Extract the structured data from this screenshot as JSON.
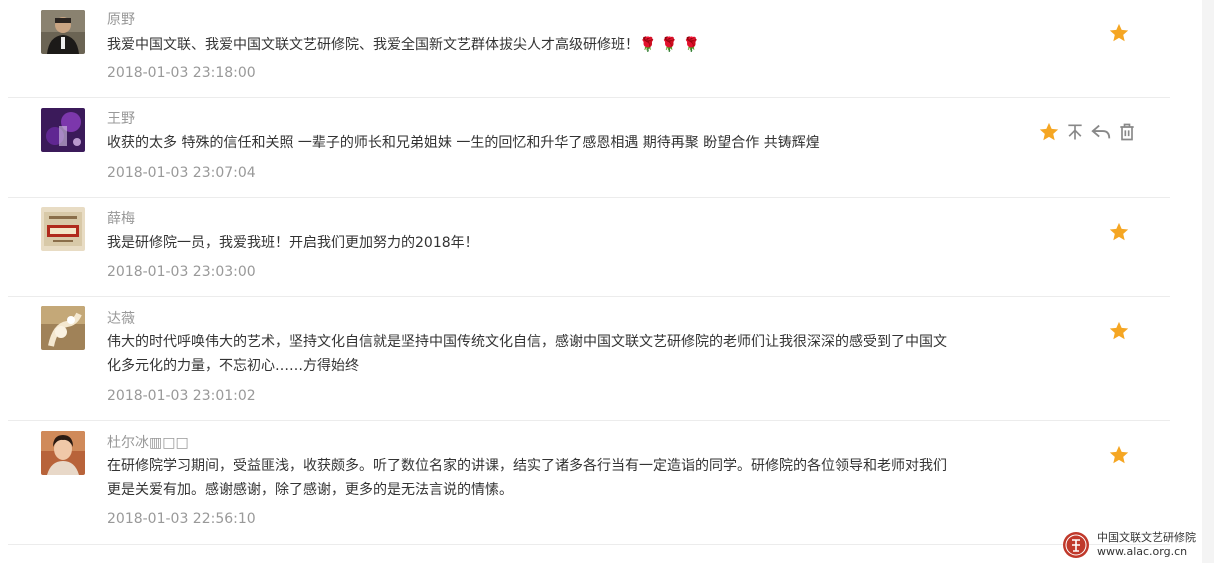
{
  "comments": [
    {
      "username": "原野",
      "content": "我爱中国文联、我爱中国文联文艺研修院、我爱全国新文艺群体拔尖人才高级研修班！",
      "emoji": "🌹 🌹 🌹",
      "time": "2018-01-03 23:18:00",
      "avatar_icon": "portrait-man-icon",
      "starred": true
    },
    {
      "username": "王野",
      "content": "收获的太多 特殊的信任和关照 一辈子的师长和兄弟姐妹 一生的回忆和升华了感恩相遇 期待再聚 盼望合作 共铸辉煌",
      "time": "2018-01-03 23:07:04",
      "avatar_icon": "purple-stage-icon",
      "starred": true,
      "actions": [
        "star-icon",
        "pin-top-icon",
        "reply-icon",
        "delete-icon"
      ]
    },
    {
      "username": "薛梅",
      "content": "我是研修院一员，我爱我班！开启我们更加努力的2018年！",
      "time": "2018-01-03 23:03:00",
      "avatar_icon": "drama-book-icon",
      "starred": true
    },
    {
      "username": "达薇",
      "content": "伟大的时代呼唤伟大的艺术，坚持文化自信就是坚持中国传统文化自信，感谢中国文联文艺研修院的老师们让我很深深的感受到了中国文化多元化的力量，不忘初心……方得始终",
      "time": "2018-01-03 23:01:02",
      "avatar_icon": "hand-flower-icon",
      "starred": true
    },
    {
      "username": "杜尔冰▥□□",
      "content": "在研修院学习期间，受益匪浅，收获颇多。听了数位名家的讲课，结实了诸多各行当有一定造诣的同学。研修院的各位领导和老师对我们更是关爱有加。感谢感谢，除了感谢，更多的是无法言说的情愫。",
      "time": "2018-01-03 22:56:10",
      "avatar_icon": "portrait-woman-icon",
      "starred": true
    }
  ],
  "footer": {
    "org_name": "中国文联文艺研修院",
    "url": "www.alac.org.cn"
  },
  "colors": {
    "star": "#f5a623",
    "icon_gray": "#888888",
    "text": "#333333",
    "meta": "#999999"
  }
}
